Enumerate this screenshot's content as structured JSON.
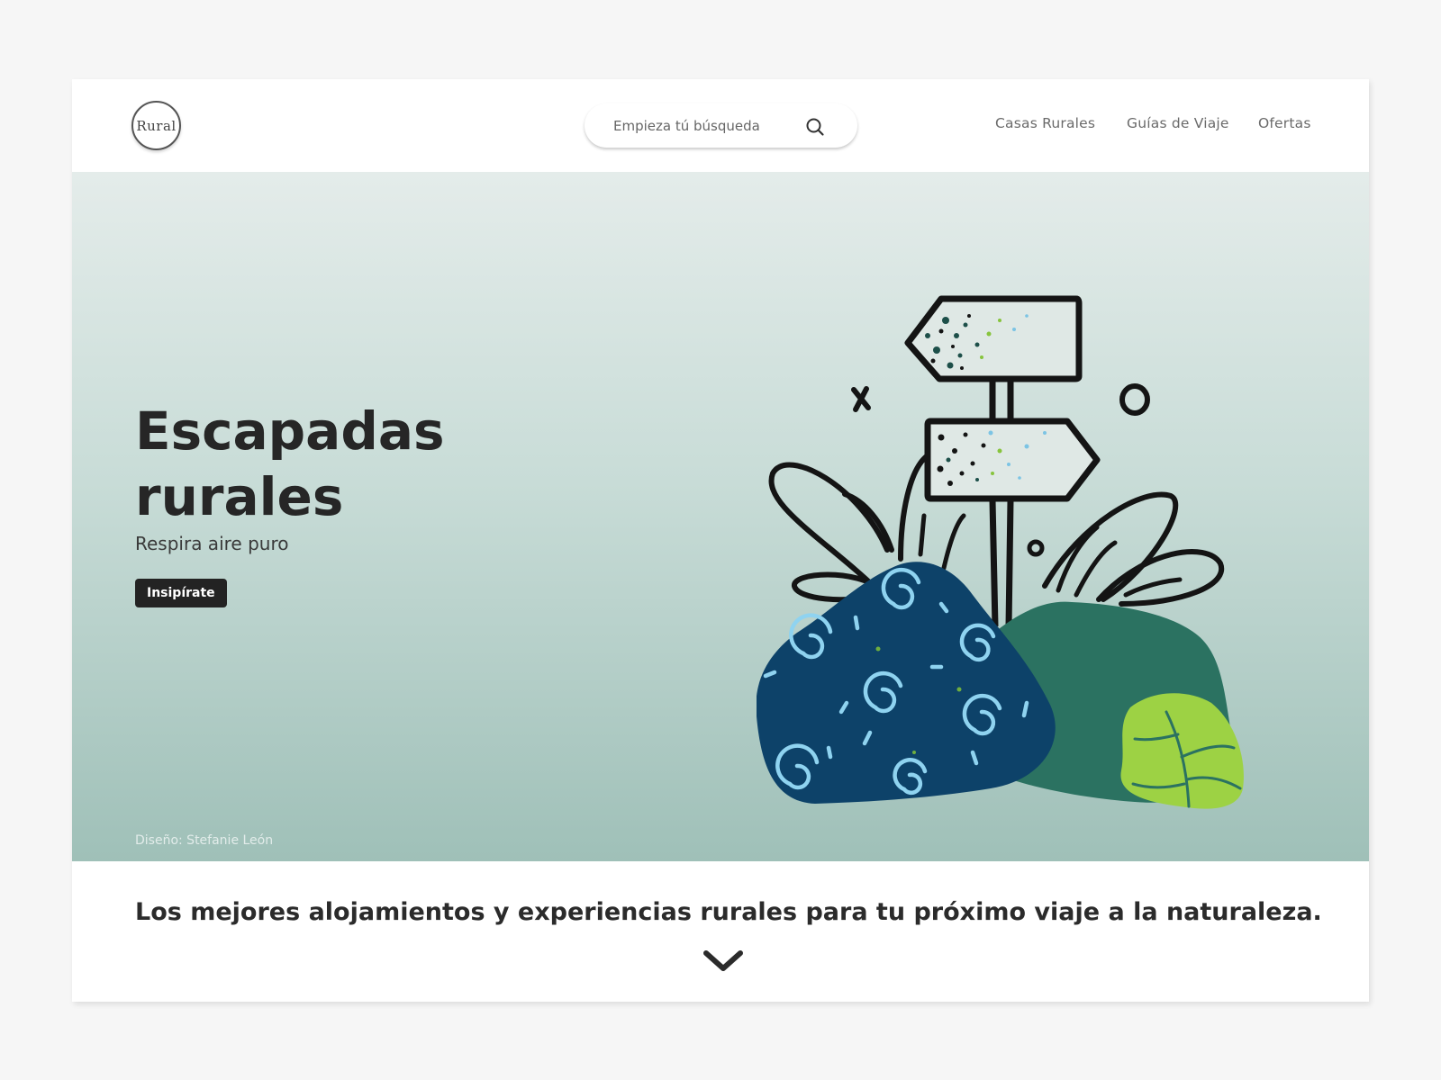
{
  "header": {
    "logo_text": "Rural",
    "search": {
      "placeholder": "Empieza tú búsqueda",
      "icon": "search-icon"
    },
    "nav": [
      {
        "label": "Casas Rurales"
      },
      {
        "label": "Guías de Viaje"
      },
      {
        "label": "Ofertas"
      }
    ]
  },
  "hero": {
    "title_line1": "Escapadas",
    "title_line2": "rurales",
    "subtitle": "Respira aire puro",
    "cta_label": "Insipírate",
    "credit": "Diseño: Stefanie León"
  },
  "intro": {
    "tagline": "Los mejores alojamientos y experiencias rurales para tu próximo viaje a la naturaleza.",
    "scroll_icon": "chevron-down-icon"
  },
  "colors": {
    "accent_dark": "#232323",
    "hero_top": "#e4ecea",
    "hero_bottom": "#9fc0b8",
    "rock_blue": "#0d4269",
    "bush_green": "#2b7261",
    "leaf_lime": "#9dd244"
  }
}
